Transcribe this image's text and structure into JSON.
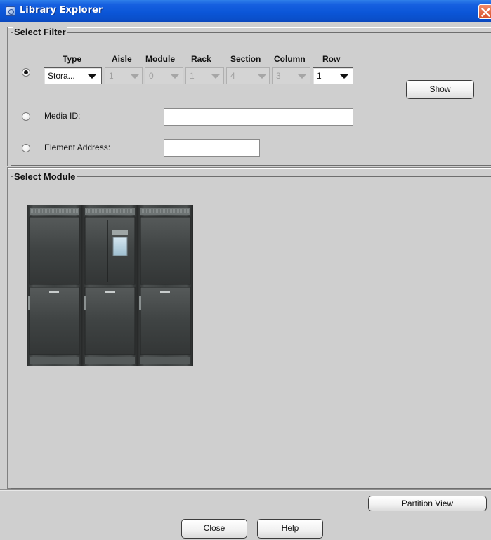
{
  "window": {
    "title": "Library Explorer",
    "icons": {
      "app": "library-app-icon",
      "close": "close-icon"
    }
  },
  "filter": {
    "legend": "Select Filter",
    "headers": {
      "type": "Type",
      "aisle": "Aisle",
      "module": "Module",
      "rack": "Rack",
      "section": "Section",
      "column": "Column",
      "row": "Row"
    },
    "values": {
      "type": "Stora...",
      "aisle": "1",
      "module": "0",
      "rack": "1",
      "section": "4",
      "column": "3",
      "row": "1"
    },
    "show_button": "Show",
    "media_id_label": "Media ID:",
    "media_id_value": "",
    "element_address_label": "Element Address:",
    "element_address_value": "",
    "selected_option": "location"
  },
  "module_panel": {
    "legend": "Select Module",
    "module_count": 3
  },
  "buttons": {
    "partition_view": "Partition View",
    "close": "Close",
    "help": "Help"
  },
  "colors": {
    "titlebar": "#0b56d8",
    "window_bg": "#cfcfcf"
  }
}
